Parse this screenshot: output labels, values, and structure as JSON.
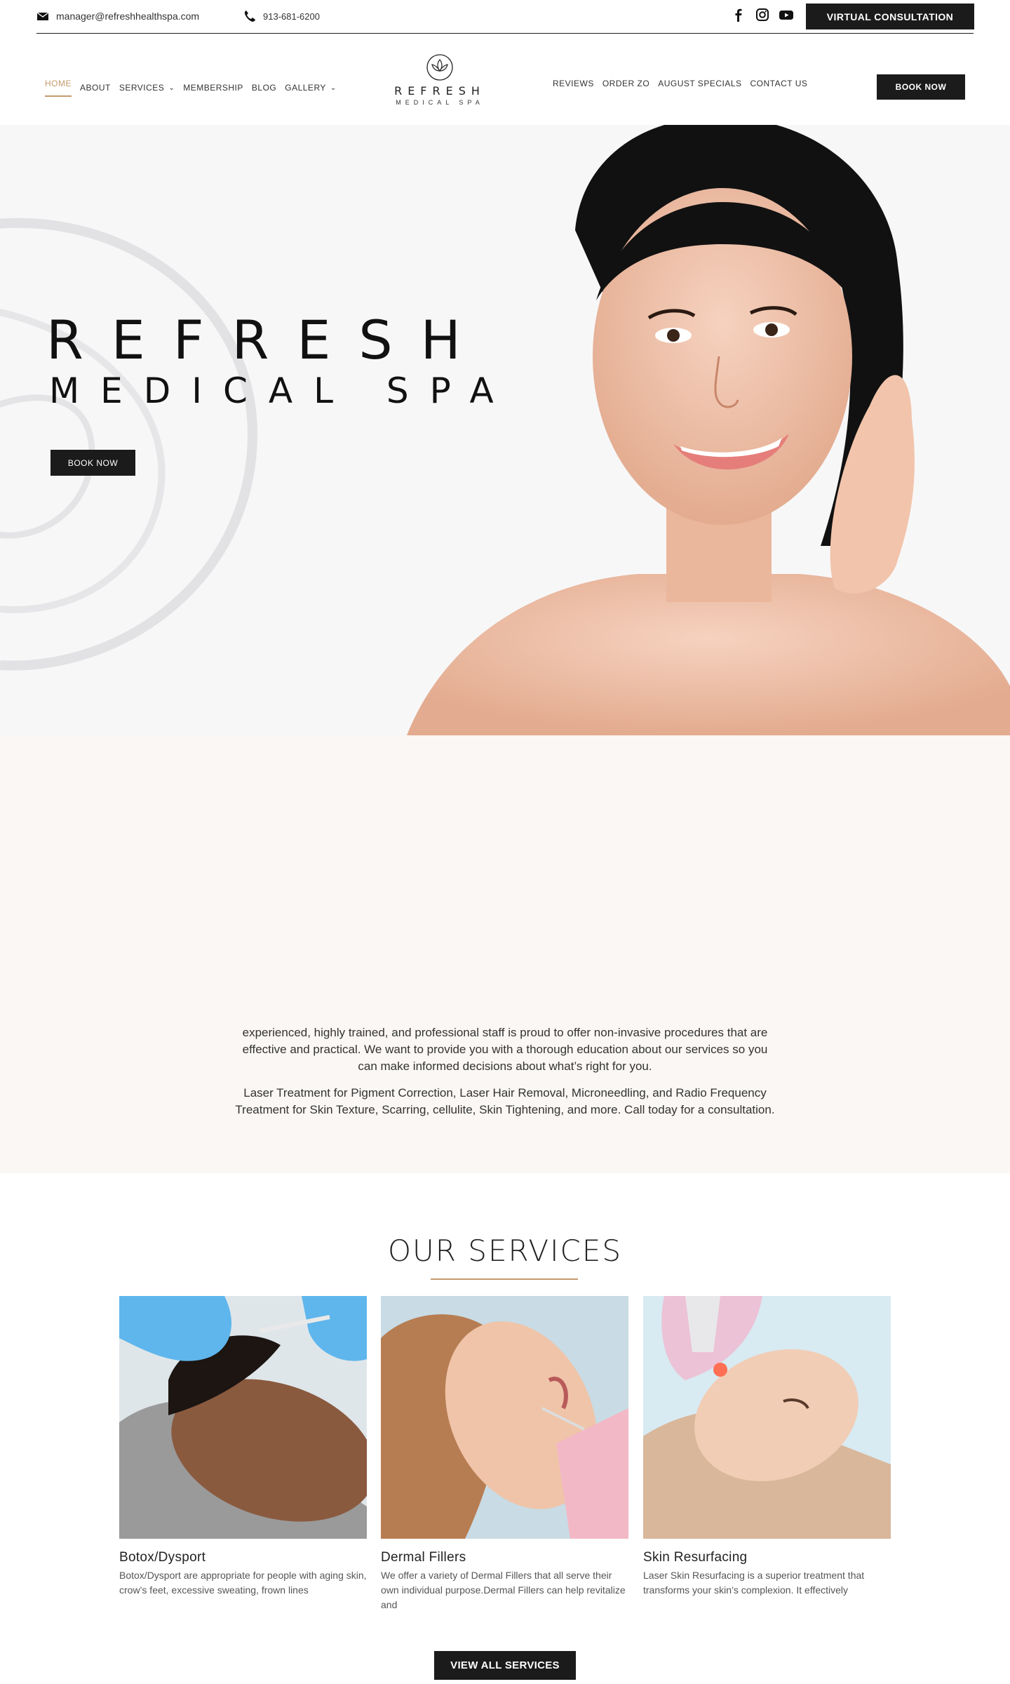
{
  "topbar": {
    "email": "manager@refreshhealthspa.com",
    "phone": "913-681-6200",
    "social": [
      "facebook-icon",
      "instagram-icon",
      "youtube-icon"
    ],
    "cta": "VIRTUAL CONSULTATION"
  },
  "nav": {
    "left": [
      {
        "label": "HOME",
        "active": true
      },
      {
        "label": "ABOUT"
      },
      {
        "label": "SERVICES",
        "dropdown": true
      },
      {
        "label": "MEMBERSHIP"
      },
      {
        "label": "BLOG"
      },
      {
        "label": "GALLERY",
        "dropdown": true
      }
    ],
    "right": [
      {
        "label": "REVIEWS"
      },
      {
        "label": "ORDER ZO"
      },
      {
        "label": "AUGUST SPECIALS"
      },
      {
        "label": "CONTACT US"
      }
    ],
    "logo_line1": "REFRESH",
    "logo_line2": "MEDICAL SPA",
    "book": "BOOK NOW"
  },
  "hero": {
    "title1": "REFRESH",
    "title2": "MEDICAL SPA",
    "cta": "BOOK NOW"
  },
  "intro": {
    "p1": "experienced, highly trained, and professional staff is proud to offer non-invasive procedures that are effective and practical. We want to provide you with a thorough education about our services so you can make informed decisions about what’s right for you.",
    "p2": "Laser Treatment for Pigment Correction, Laser Hair Removal, Microneedling, and Radio Frequency Treatment for Skin Texture, Scarring, cellulite, Skin Tightening, and more. Call today for a consultation."
  },
  "services": {
    "title": "OUR SERVICES",
    "cards": [
      {
        "title": "Botox/Dysport",
        "text": "Botox/Dysport are appropriate for people with aging skin, crow’s feet, excessive sweating, frown lines"
      },
      {
        "title": "Dermal Fillers",
        "text": "We offer a variety of Dermal Fillers that all serve their own individual purpose.Dermal Fillers can help revitalize and"
      },
      {
        "title": "Skin Resurfacing",
        "text": "Laser Skin Resurfacing is a superior treatment that transforms your skin’s complexion. It effectively"
      }
    ],
    "cta": "VIEW ALL SERVICES"
  },
  "colors": {
    "accent": "#c49a6c",
    "dark": "#1b1b1b",
    "cream": "#faf7f4"
  }
}
